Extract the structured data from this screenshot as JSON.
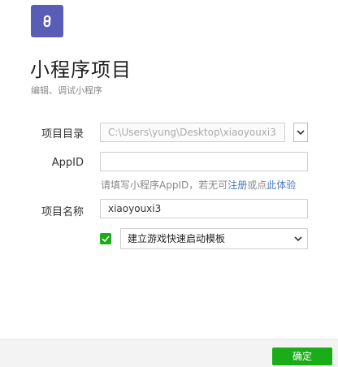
{
  "header": {
    "logo_icon": "mini-program-logo-icon",
    "logo_color": "#5a5db5",
    "title": "小程序项目",
    "subtitle": "编辑、调试小程序"
  },
  "form": {
    "project_dir": {
      "label": "项目目录",
      "value": "C:\\Users\\yung\\Desktop\\xiaoyouxi3",
      "dropdown_icon": "chevron-down-icon"
    },
    "appid": {
      "label": "AppID",
      "value": "",
      "hint_prefix": "请填写小程序AppID，若无可",
      "hint_register": "注册",
      "hint_or": "或点",
      "hint_trial": "此体验"
    },
    "project_name": {
      "label": "项目名称",
      "value": "xiaoyouxi3"
    },
    "template": {
      "checked": true,
      "check_color": "#1aad19",
      "selected": "建立游戏快速启动模板"
    }
  },
  "footer": {
    "confirm_label": "确定",
    "confirm_color": "#1aad19"
  }
}
